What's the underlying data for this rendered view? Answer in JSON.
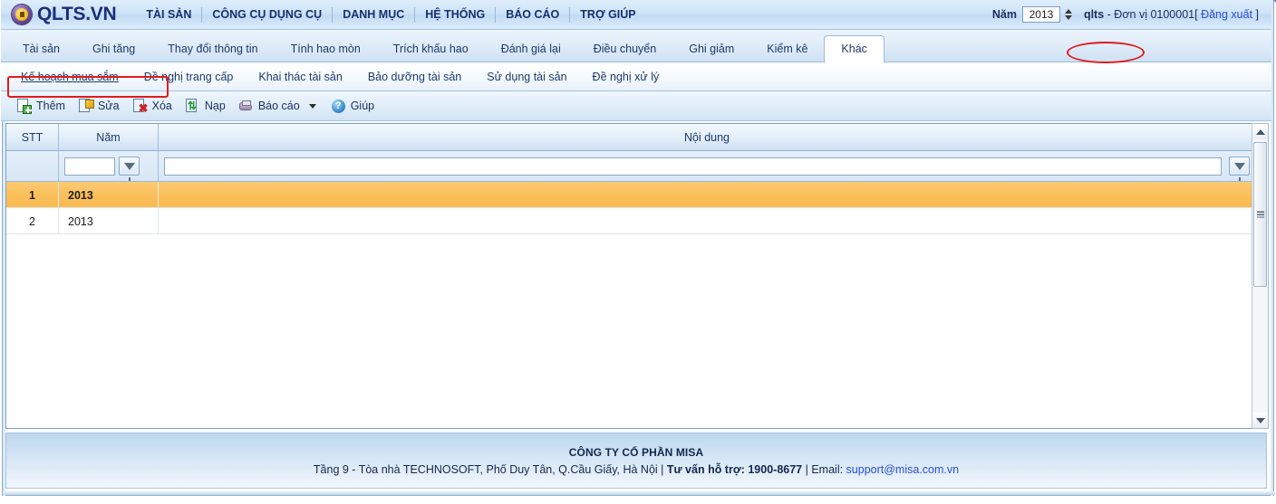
{
  "brand": {
    "name": "QLTS.VN",
    "tm": "™",
    "logo_icon": "lock-circle-logo-icon"
  },
  "topbar": {
    "menu": [
      "TÀI SẢN",
      "CÔNG CỤ DỤNG CỤ",
      "DANH MỤC",
      "HỆ THỐNG",
      "BÁO CÁO",
      "TRỢ GIÚP"
    ],
    "year_label": "Năm",
    "year_value": "2013",
    "spinner_icon": "spinner-updown-icon",
    "user": "qlts",
    "user_sep": " - ",
    "unit_label": "Đơn vị 0100001",
    "logout_open": "[ ",
    "logout": "Đăng xuất",
    "logout_close": " ]"
  },
  "tabs_level1": {
    "items": [
      "Tài sản",
      "Ghi tăng",
      "Thay đổi thông tin",
      "Tính hao mòn",
      "Trích khấu hao",
      "Đánh giá lại",
      "Điều chuyển",
      "Ghi giảm",
      "Kiểm kê",
      "Khác"
    ],
    "active_index": 9
  },
  "tabs_level2": {
    "items": [
      "Kế hoạch mua sắm",
      "Đề nghị trang cấp",
      "Khai thác tài sản",
      "Bảo dưỡng tài sản",
      "Sử dụng tài sản",
      "Đề nghị xử lý"
    ],
    "selected_index": 0
  },
  "toolbar": {
    "buttons": [
      {
        "label": "Thêm",
        "icon": "add-page-icon"
      },
      {
        "label": "Sửa",
        "icon": "edit-pencil-icon"
      },
      {
        "label": "Xóa",
        "icon": "delete-page-icon"
      },
      {
        "label": "Nạp",
        "icon": "refresh-page-icon"
      },
      {
        "label": "Báo cáo",
        "icon": "printer-report-icon"
      },
      {
        "label": "Giúp",
        "icon": "help-question-icon"
      }
    ],
    "dropdown_icon": "caret-down-icon",
    "help_glyph": "?"
  },
  "grid": {
    "columns": [
      {
        "key": "stt",
        "label": "STT"
      },
      {
        "key": "nam",
        "label": "Năm"
      },
      {
        "key": "noidung",
        "label": "Nội dung"
      }
    ],
    "filter_row": {
      "nam_value": "",
      "nam_placeholder": "",
      "noidung_value": "",
      "noidung_placeholder": "",
      "funnel_icon": "filter-funnel-icon"
    },
    "rows": [
      {
        "stt": "1",
        "nam": "2013",
        "noidung": "",
        "selected": true
      },
      {
        "stt": "2",
        "nam": "2013",
        "noidung": "",
        "selected": false
      }
    ]
  },
  "scrollbar": {
    "up_icon": "scroll-up-arrow-icon",
    "down_icon": "scroll-down-arrow-icon",
    "thumb_grip_icon": "scroll-thumb-grip-icon"
  },
  "footer": {
    "company": "CÔNG TY CỔ PHẦN MISA",
    "address": "Tầng 9 - Tòa nhà TECHNOSOFT, Phố Duy Tân, Q.Cầu Giấy, Hà Nội | ",
    "support_label": "Tư vấn hỗ trợ: 1900-8677",
    "email_label": " | Email: ",
    "email": "support@misa.com.vn"
  },
  "annotations": {
    "ellipse_target": "Khác",
    "rect_target": "Kế hoạch mua sắm",
    "color": "#e01b1b"
  },
  "colors": {
    "brand_blue": "#1b2f7a",
    "accent_selected_row": "#fbc05c",
    "link": "#2a4fd6",
    "annotation_red": "#e01b1b"
  }
}
